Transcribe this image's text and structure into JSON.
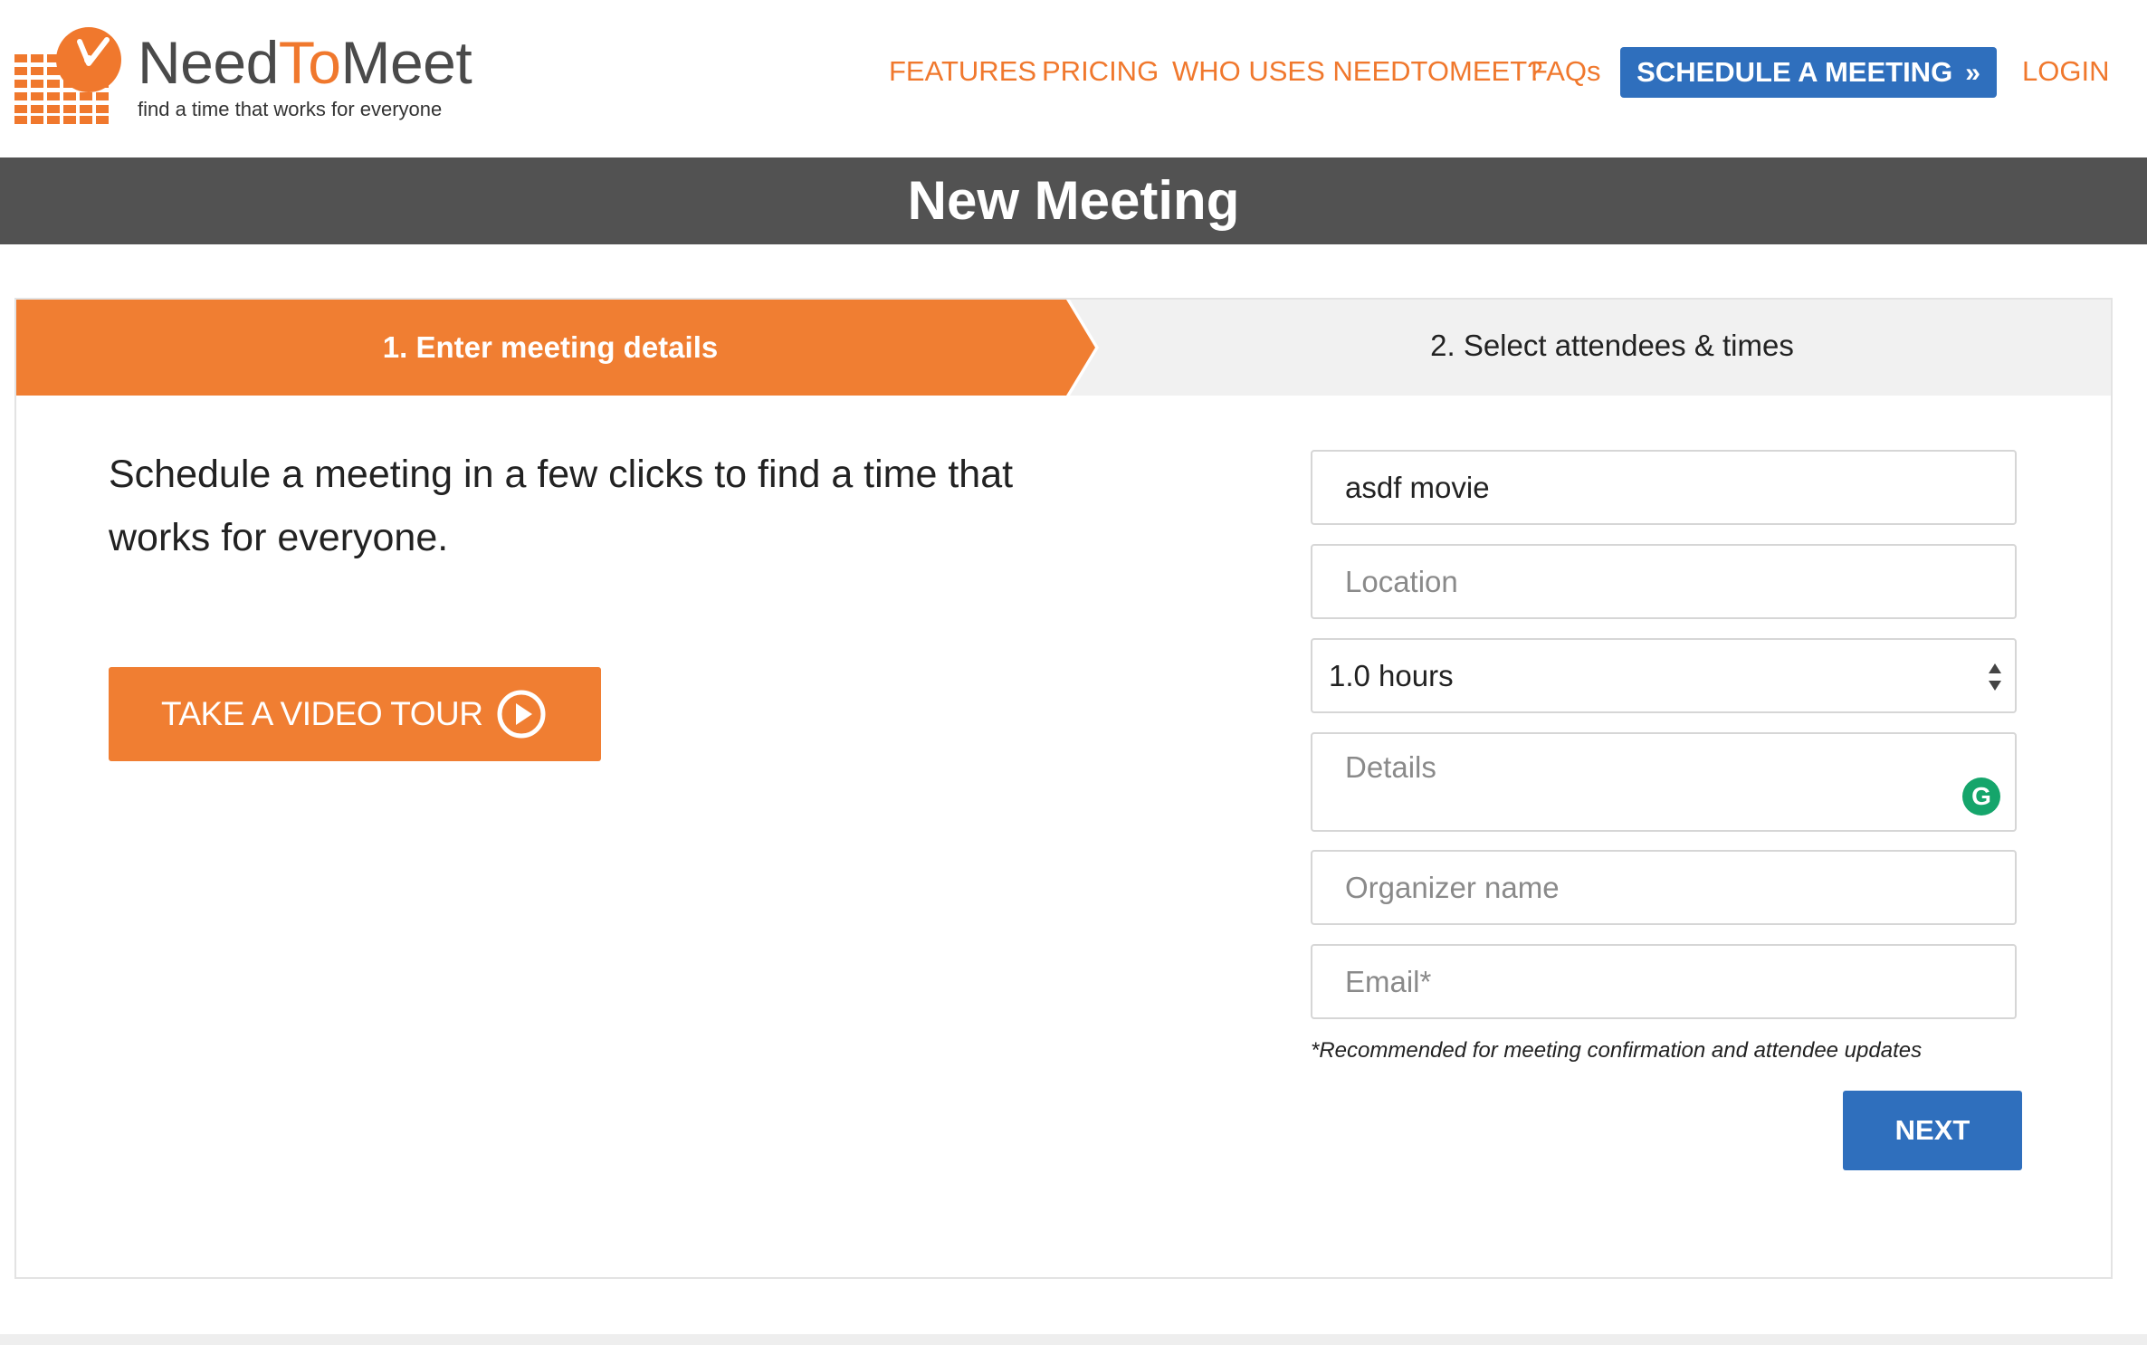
{
  "brand": {
    "name_part1": "Need",
    "name_part2": "To",
    "name_part3": "Meet",
    "tagline": "find a time that works for everyone",
    "primary_color": "#f0782d",
    "secondary_color": "#2f6fbd"
  },
  "nav": {
    "features": "FEATURES",
    "pricing": "PRICING",
    "who_uses": "WHO USES NEEDTOMEET?",
    "faqs": "FAQs",
    "schedule": "SCHEDULE A MEETING",
    "schedule_icon": "double-chevron-right-icon",
    "login": "LOGIN"
  },
  "page": {
    "title": "New Meeting"
  },
  "steps": {
    "step1": "1. Enter meeting details",
    "step2": "2. Select attendees & times",
    "active": 1
  },
  "intro": {
    "text": "Schedule a meeting in a few clicks to find a time that works for everyone.",
    "video_button": "TAKE A VIDEO TOUR",
    "video_icon": "play-circle-icon"
  },
  "form": {
    "title_value": "asdf movie",
    "location_placeholder": "Location",
    "duration_value": "1.0 hours",
    "details_placeholder": "Details",
    "organizer_placeholder": "Organizer name",
    "email_placeholder": "Email*",
    "note": "*Recommended for meeting confirmation and attendee updates",
    "next_button": "NEXT",
    "grammarly_icon": "grammarly-icon"
  }
}
